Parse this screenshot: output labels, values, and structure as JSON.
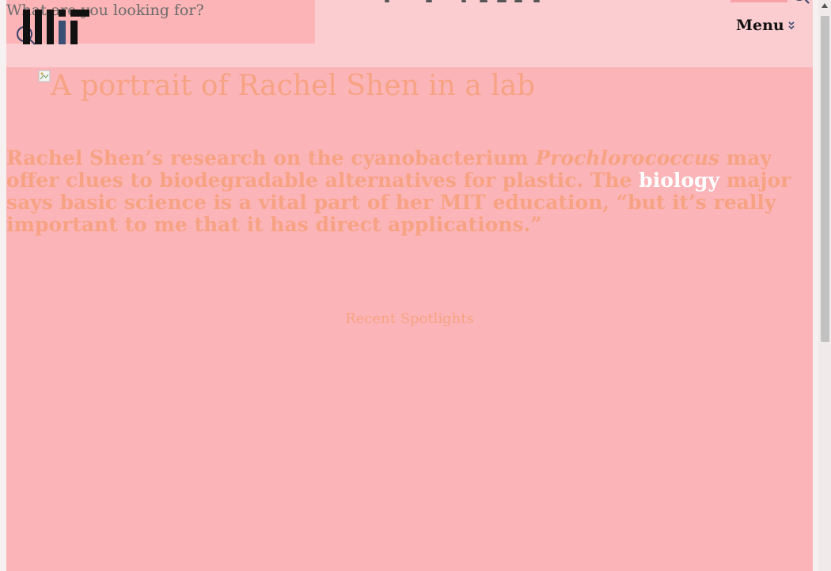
{
  "header": {
    "search_placeholder": "What are you looking for?",
    "menu_label": "Menu",
    "logo_name": "MIT"
  },
  "hero": {
    "portrait_alt": "A portrait of Rachel Shen in a lab"
  },
  "intro": {
    "part1": "Rachel Shen’s research on the cyanobacterium ",
    "organism": "Prochlorococcus",
    "part2": " may offer clues to biodegradable alternatives for plastic. The ",
    "link": "biology",
    "part3": " major says basic science is a vital part of her MIT education, “but it’s really important to me that it has direct applications.”"
  },
  "recent": {
    "title": "Recent Spotlights"
  },
  "colors": {
    "page_bg": "#fbb5b8",
    "header_bg": "#fbcdd0",
    "accent_text": "#f7a283",
    "link": "#ffffff"
  },
  "icons": [
    "search-icon",
    "chevron-down-icon",
    "broken-image-icon",
    "mit-logo"
  ]
}
